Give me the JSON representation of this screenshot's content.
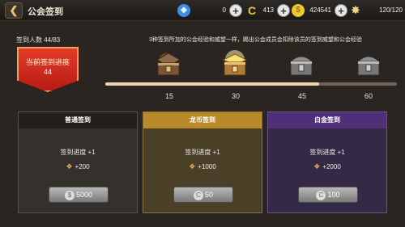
{
  "header": {
    "back_icon": "chevron-left-icon",
    "title": "公会签到"
  },
  "resources": [
    {
      "name": "gem",
      "icon": "gem-icon",
      "value": "0"
    },
    {
      "name": "dragon-coin",
      "icon": "dragon-coin-icon",
      "value": "413"
    },
    {
      "name": "gold",
      "icon": "gold-coin-icon",
      "value": "424541"
    },
    {
      "name": "stamina",
      "icon": "flame-icon",
      "value": "120/120"
    }
  ],
  "info": {
    "member_count": "签到人数 44/83",
    "description": "3种签到所加的公会经验和威望一样，踢出公会成员会扣除该员的签到威望和公会经验"
  },
  "progress_banner": {
    "label": "当前签到进度",
    "value": "44"
  },
  "track": {
    "current": 44,
    "max": 60,
    "milestones": [
      {
        "label": "15",
        "value": 15,
        "state": "claimed"
      },
      {
        "label": "30",
        "value": 30,
        "state": "available"
      },
      {
        "label": "45",
        "value": 45,
        "state": "locked"
      },
      {
        "label": "60",
        "value": 60,
        "state": "locked"
      }
    ]
  },
  "panels": [
    {
      "title": "普通签到",
      "progress": "签到进度 +1",
      "reward": "+200",
      "button": "5000",
      "button_icon": "gold-coin-icon"
    },
    {
      "title": "龙币签到",
      "progress": "签到进度 +1",
      "reward": "+1000",
      "button": "50",
      "button_icon": "dragon-coin-icon"
    },
    {
      "title": "白金签到",
      "progress": "签到进度 +1",
      "reward": "+2000",
      "button": "100",
      "button_icon": "dragon-coin-icon"
    }
  ],
  "colors": {
    "accent_red": "#e23b28",
    "dragon_gold": "#b88a2a",
    "platinum_purple": "#4e2f78"
  }
}
